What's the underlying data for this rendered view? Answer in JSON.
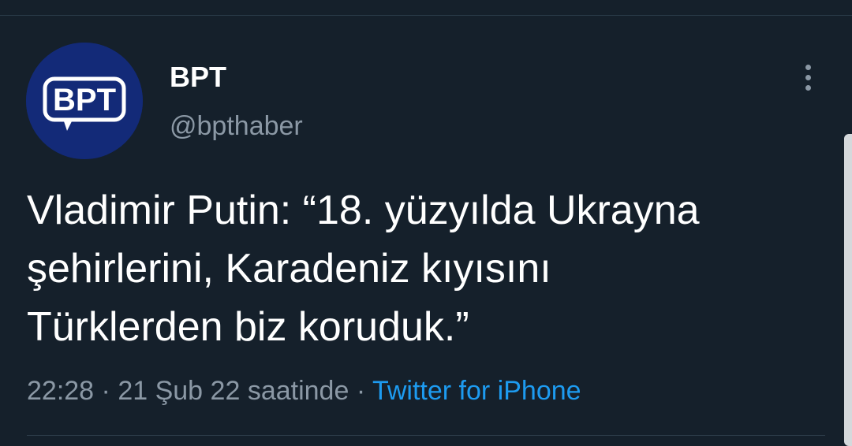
{
  "tweet": {
    "author": {
      "display_name": "BPT",
      "handle": "@bpthaber",
      "avatar_text": "BPT"
    },
    "text_lines": [
      "Vladimir Putin: “18. yüzyılda Ukrayna",
      "şehirlerini, Karadeniz kıyısını",
      "Türklerden biz koruduk.”"
    ],
    "time": "22:28",
    "date": "21 Şub 22",
    "suffix": "saatinde",
    "separator": "·",
    "source": "Twitter for iPhone"
  },
  "icons": {
    "more": "more-vertical-icon"
  },
  "colors": {
    "background": "#15202b",
    "text": "#ffffff",
    "secondary": "#8b98a5",
    "accent": "#1d9bf0",
    "avatar": "#132a78"
  }
}
